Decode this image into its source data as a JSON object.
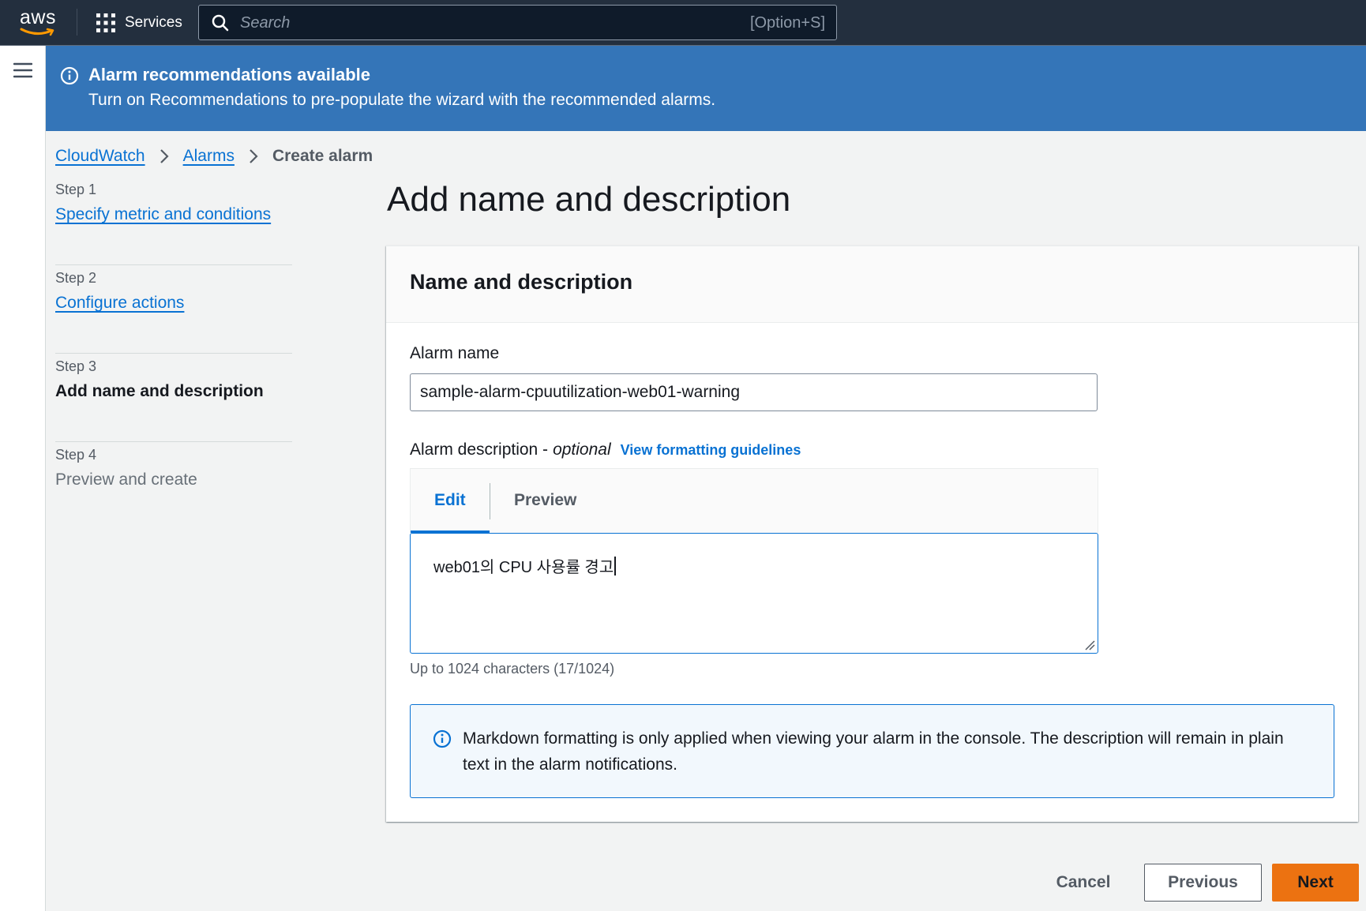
{
  "topnav": {
    "logo_text": "aws",
    "services_label": "Services",
    "search_placeholder": "Search",
    "search_shortcut": "[Option+S]"
  },
  "flash": {
    "title": "Alarm recommendations available",
    "description": "Turn on Recommendations to pre-populate the wizard with the recommended alarms."
  },
  "breadcrumb": {
    "items": [
      "CloudWatch",
      "Alarms"
    ],
    "current": "Create alarm"
  },
  "steps": [
    {
      "num": "Step 1",
      "name": "Specify metric and conditions",
      "state": "link"
    },
    {
      "num": "Step 2",
      "name": "Configure actions",
      "state": "link"
    },
    {
      "num": "Step 3",
      "name": "Add name and description",
      "state": "active"
    },
    {
      "num": "Step 4",
      "name": "Preview and create",
      "state": "disabled"
    }
  ],
  "page_title": "Add name and description",
  "section": {
    "header": "Name and description",
    "alarm_name_label": "Alarm name",
    "alarm_name_value": "sample-alarm-cpuutilization-web01-warning",
    "desc_label": "Alarm description -",
    "desc_optional": "optional",
    "desc_guidelines": "View formatting guidelines",
    "tabs": {
      "edit": "Edit",
      "preview": "Preview"
    },
    "desc_value": "web01의 CPU 사용률 경고",
    "constraint": "Up to 1024 characters (17/1024)",
    "info_text": "Markdown formatting is only applied when viewing your alarm in the console. The description will remain in plain text in the alarm notifications."
  },
  "actions": {
    "cancel": "Cancel",
    "previous": "Previous",
    "next": "Next"
  },
  "colors": {
    "nav_bg": "#232f3e",
    "flash_bg": "#3475b8",
    "link": "#0972d3",
    "primary_button": "#ec7211"
  }
}
